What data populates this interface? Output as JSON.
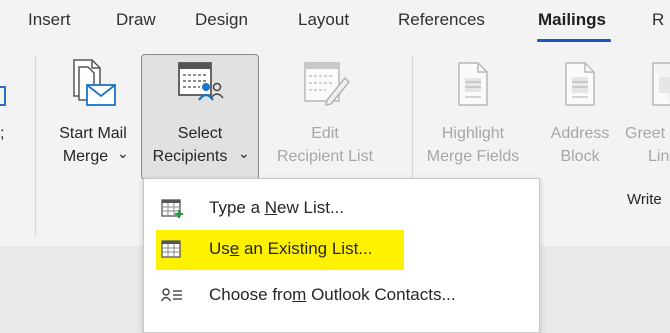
{
  "tabs": [
    "Insert",
    "Draw",
    "Design",
    "Layout",
    "References",
    "Mailings",
    "R"
  ],
  "active_tab": "Mailings",
  "ribbon": {
    "start_mail_merge": {
      "line1": "Start Mail",
      "line2": "Merge",
      "caret": "⌄"
    },
    "select_recipients": {
      "line1": "Select",
      "line2": "Recipients",
      "caret": "⌄"
    },
    "edit_recipient_list": {
      "line1": "Edit",
      "line2": "Recipient List"
    },
    "highlight_merge_fields": {
      "line1": "Highlight",
      "line2": "Merge Fields"
    },
    "address_block": {
      "line1": "Address",
      "line2": "Block"
    },
    "greeting_line": {
      "line1": "Greet",
      "line2": "Lin"
    },
    "group_label": "Write"
  },
  "menu": {
    "items": [
      {
        "pre": "Type a ",
        "u": "N",
        "post": "ew List...",
        "icon": "table-new-icon",
        "highlighted": false
      },
      {
        "pre": "Us",
        "u": "e",
        "post": " an Existing List...",
        "icon": "table-existing-icon",
        "highlighted": true
      },
      {
        "pre": "Choose fro",
        "u": "m",
        "post": " Outlook Contacts...",
        "icon": "contacts-list-icon",
        "highlighted": false
      }
    ]
  },
  "colors": {
    "accent": "#185abd",
    "highlight": "#fff200",
    "disabled_text": "#a6a6a6"
  }
}
